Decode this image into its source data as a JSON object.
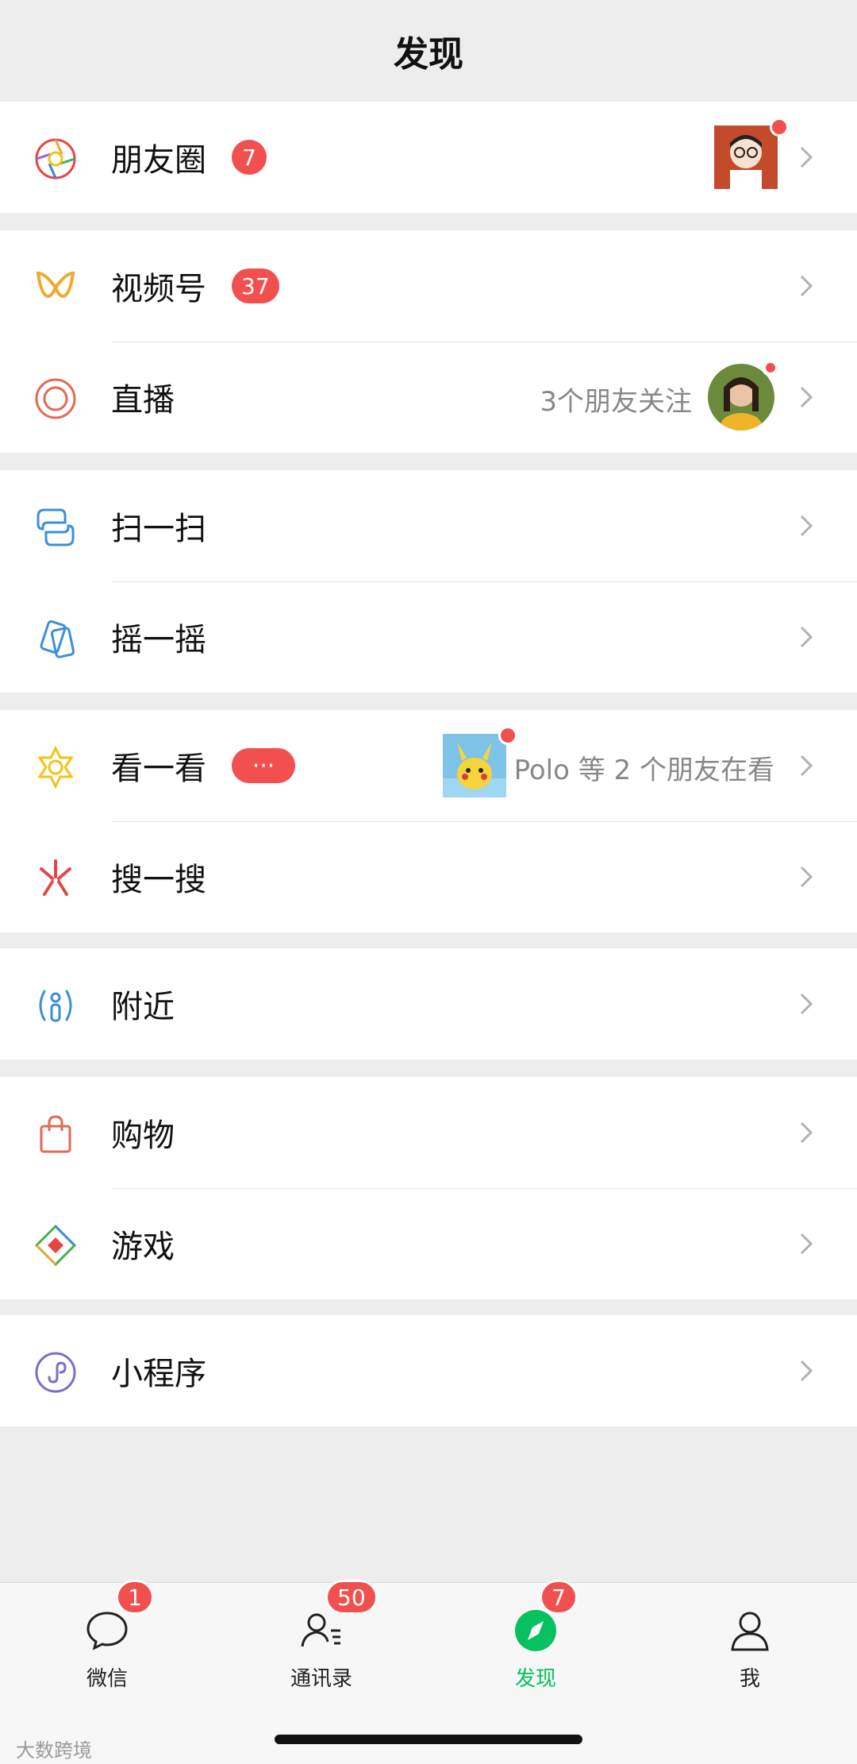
{
  "header": {
    "title": "发现"
  },
  "sections": {
    "moments": {
      "label": "朋友圈",
      "badge": "7"
    },
    "channels": {
      "label": "视频号",
      "badge": "37"
    },
    "live": {
      "label": "直播",
      "subtext": "3个朋友关注"
    },
    "scan": {
      "label": "扫一扫"
    },
    "shake": {
      "label": "摇一摇"
    },
    "top_stories": {
      "label": "看一看",
      "badge": "···",
      "subtext": "Polo 等 2 个朋友在看"
    },
    "search": {
      "label": "搜一搜"
    },
    "nearby": {
      "label": "附近"
    },
    "shopping": {
      "label": "购物"
    },
    "games": {
      "label": "游戏"
    },
    "mini_programs": {
      "label": "小程序"
    }
  },
  "tabbar": {
    "tabs": [
      {
        "label": "微信",
        "badge": "1",
        "icon": "chat-bubble-icon"
      },
      {
        "label": "通讯录",
        "badge": "50",
        "icon": "contacts-icon"
      },
      {
        "label": "发现",
        "badge": "7",
        "icon": "compass-icon",
        "active": true
      },
      {
        "label": "我",
        "badge": "",
        "icon": "person-icon"
      }
    ],
    "active_color": "#07c160"
  },
  "colors": {
    "badge": "#f24f4f",
    "background": "#ededed"
  },
  "watermark": "大数跨境"
}
